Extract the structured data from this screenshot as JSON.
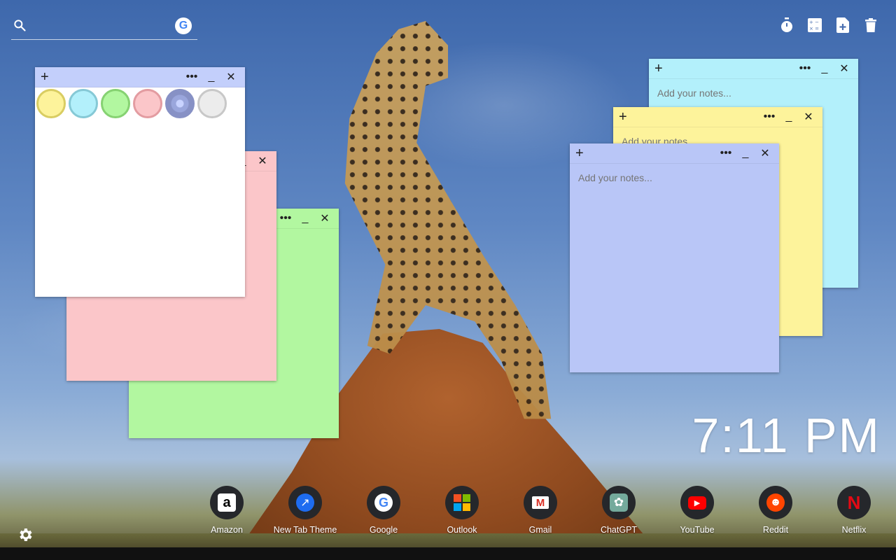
{
  "search": {
    "placeholder": "",
    "value": "",
    "engine_icon": "google-g-icon",
    "engine_letter": "G"
  },
  "toolbar": {
    "icons": [
      "timer-icon",
      "calculator-icon",
      "add-note-icon",
      "trash-icon"
    ]
  },
  "notes": {
    "palette_note": {
      "add": "+",
      "more": "•••",
      "minimize": "_",
      "close": "✕",
      "swatches": [
        {
          "name": "yellow",
          "fill": "#fdf39b",
          "border": "#d9cd62"
        },
        {
          "name": "cyan",
          "fill": "#b3f0fb",
          "border": "#86c9d6"
        },
        {
          "name": "green",
          "fill": "#b2f7a0",
          "border": "#86d272"
        },
        {
          "name": "pink",
          "fill": "#fbc6c9",
          "border": "#e39ca1"
        },
        {
          "name": "indigo",
          "fill": "#b9c6f7",
          "border": "#8791c5",
          "selected": true
        },
        {
          "name": "gray",
          "fill": "#ececec",
          "border": "#c8c8c8"
        }
      ]
    },
    "pink_note": {
      "minimize": "_",
      "close": "✕",
      "color": "#fbc6c9"
    },
    "green_note": {
      "more": "•••",
      "minimize": "_",
      "close": "✕",
      "color": "#b2f7a0"
    },
    "cyan_note": {
      "add": "+",
      "more": "•••",
      "minimize": "_",
      "close": "✕",
      "placeholder": "Add your notes...",
      "color": "#b3f0fb"
    },
    "yellow_note": {
      "add": "+",
      "more": "•••",
      "minimize": "_",
      "close": "✕",
      "placeholder": "Add your notes...",
      "color": "#fdf39b"
    },
    "blue_note": {
      "add": "+",
      "more": "•••",
      "minimize": "_",
      "close": "✕",
      "placeholder": "Add your notes...",
      "color": "#b9c6f7"
    }
  },
  "clock": {
    "time": "7:11 PM"
  },
  "dock": {
    "apps": [
      {
        "label": "Amazon",
        "glyph": "a",
        "icon": "amazon-icon",
        "glyph_color": "#000",
        "bg": "#fff"
      },
      {
        "label": "New Tab Theme",
        "glyph": "↗",
        "icon": "new-tab-theme-icon",
        "glyph_color": "#fff",
        "bg": "#1e6cf0"
      },
      {
        "label": "Google",
        "glyph": "G",
        "icon": "google-icon",
        "glyph_color": "#4285f4",
        "bg": "#fff"
      },
      {
        "label": "Outlook",
        "glyph": "",
        "icon": "microsoft-icon",
        "glyph_color": "",
        "bg": ""
      },
      {
        "label": "Gmail",
        "glyph": "M",
        "icon": "gmail-icon",
        "glyph_color": "#d93025",
        "bg": "#fff"
      },
      {
        "label": "ChatGPT",
        "glyph": "✿",
        "icon": "chatgpt-icon",
        "glyph_color": "#fff",
        "bg": "#74aa9c"
      },
      {
        "label": "YouTube",
        "glyph": "▶",
        "icon": "youtube-icon",
        "glyph_color": "#fff",
        "bg": "#ff0000"
      },
      {
        "label": "Reddit",
        "glyph": "☻",
        "icon": "reddit-icon",
        "glyph_color": "#fff",
        "bg": "#ff4500"
      },
      {
        "label": "Netflix",
        "glyph": "N",
        "icon": "netflix-icon",
        "glyph_color": "#e50914",
        "bg": "transparent"
      }
    ]
  },
  "settings": {
    "icon": "gear-icon"
  }
}
